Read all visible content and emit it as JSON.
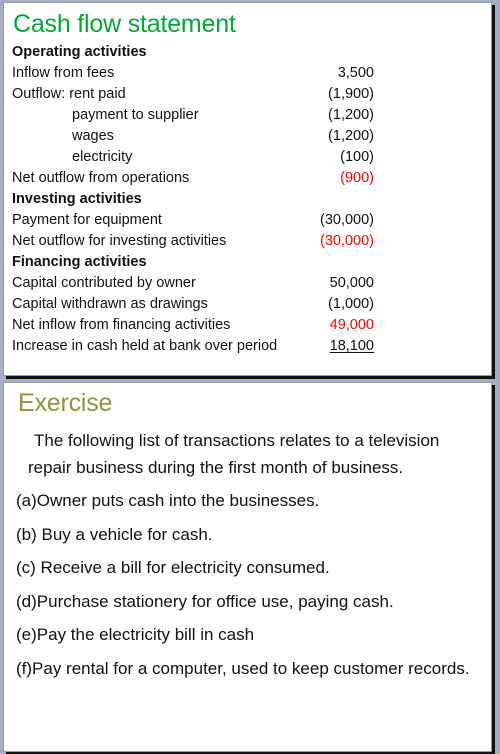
{
  "theme": {
    "page_background": "#a7adc3",
    "slide_background": "#ffffff",
    "cashflow_title_color": "#00a933",
    "exercise_title_color": "#8a9a3a",
    "total_highlight_color": "#ff0000",
    "body_text_color": "#111111"
  },
  "cashflow": {
    "title": "Cash flow statement",
    "rows": [
      {
        "label": "Operating activities",
        "value": "",
        "style": "heading"
      },
      {
        "label": "Inflow from fees",
        "value": "3,500",
        "style": "normal"
      },
      {
        "label": "Outflow: rent paid",
        "value": "(1,900)",
        "style": "normal"
      },
      {
        "label": "payment to supplier",
        "value": "(1,200)",
        "style": "indent"
      },
      {
        "label": "wages",
        "value": "(1,200)",
        "style": "indent"
      },
      {
        "label": "electricity",
        "value": "(100)",
        "style": "indent"
      },
      {
        "label": "Net outflow from operations",
        "value": "(900)",
        "style": "total"
      },
      {
        "label": "Investing activities",
        "value": "",
        "style": "heading"
      },
      {
        "label": "Payment for equipment",
        "value": "(30,000)",
        "style": "normal"
      },
      {
        "label": "Net outflow for investing activities",
        "value": "(30,000)",
        "style": "total"
      },
      {
        "label": "Financing activities",
        "value": "",
        "style": "heading"
      },
      {
        "label": "Capital contributed by owner",
        "value": "50,000",
        "style": "normal"
      },
      {
        "label": "Capital withdrawn as drawings",
        "value": "(1,000)",
        "style": "normal"
      },
      {
        "label": "Net inflow from financing activities",
        "value": "49,000",
        "style": "total"
      },
      {
        "label": "Increase in cash held at bank over period",
        "value": "18,100",
        "style": "grand-total"
      }
    ]
  },
  "exercise": {
    "title": "Exercise",
    "intro": "The following list of transactions relates to a television repair business during the first month of business.",
    "items": [
      "(a)Owner puts cash into the businesses.",
      "(b) Buy a vehicle for cash.",
      "(c) Receive a bill for electricity consumed.",
      "(d)Purchase stationery for office use, paying cash.",
      "(e)Pay the electricity bill in cash",
      "(f)Pay rental for a computer, used to keep customer records."
    ]
  }
}
